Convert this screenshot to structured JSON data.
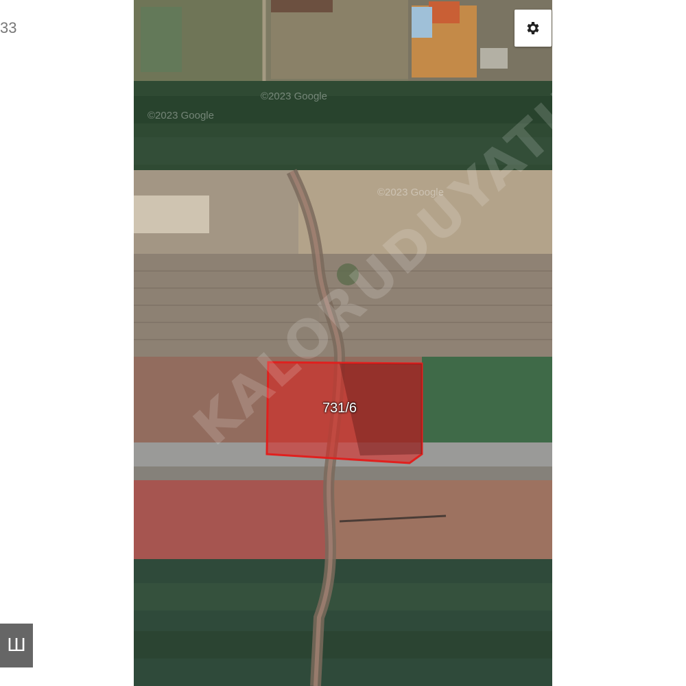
{
  "page": {
    "left_number": "33",
    "left_badge_glyph": "Ш"
  },
  "map": {
    "parcel_label": "731/6",
    "parcel_color": "#e0201e",
    "attribution_1": "©2023 Google",
    "attribution_2": "©2023 Google",
    "attribution_3": "©2023 Google",
    "watermark": "KALORUDUYATIRIM.COM"
  },
  "controls": {
    "settings_icon": "gear-icon"
  }
}
